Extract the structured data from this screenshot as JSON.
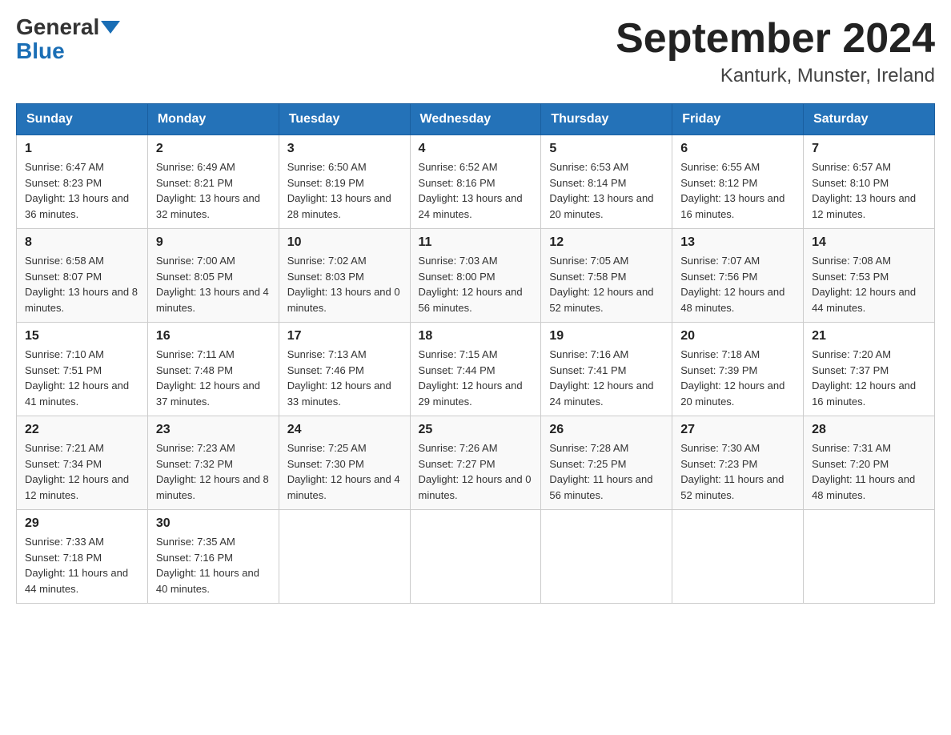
{
  "header": {
    "logo_general": "General",
    "logo_blue": "Blue",
    "title": "September 2024",
    "subtitle": "Kanturk, Munster, Ireland"
  },
  "days_of_week": [
    "Sunday",
    "Monday",
    "Tuesday",
    "Wednesday",
    "Thursday",
    "Friday",
    "Saturday"
  ],
  "weeks": [
    [
      {
        "day": "1",
        "sunrise": "6:47 AM",
        "sunset": "8:23 PM",
        "daylight": "13 hours and 36 minutes."
      },
      {
        "day": "2",
        "sunrise": "6:49 AM",
        "sunset": "8:21 PM",
        "daylight": "13 hours and 32 minutes."
      },
      {
        "day": "3",
        "sunrise": "6:50 AM",
        "sunset": "8:19 PM",
        "daylight": "13 hours and 28 minutes."
      },
      {
        "day": "4",
        "sunrise": "6:52 AM",
        "sunset": "8:16 PM",
        "daylight": "13 hours and 24 minutes."
      },
      {
        "day": "5",
        "sunrise": "6:53 AM",
        "sunset": "8:14 PM",
        "daylight": "13 hours and 20 minutes."
      },
      {
        "day": "6",
        "sunrise": "6:55 AM",
        "sunset": "8:12 PM",
        "daylight": "13 hours and 16 minutes."
      },
      {
        "day": "7",
        "sunrise": "6:57 AM",
        "sunset": "8:10 PM",
        "daylight": "13 hours and 12 minutes."
      }
    ],
    [
      {
        "day": "8",
        "sunrise": "6:58 AM",
        "sunset": "8:07 PM",
        "daylight": "13 hours and 8 minutes."
      },
      {
        "day": "9",
        "sunrise": "7:00 AM",
        "sunset": "8:05 PM",
        "daylight": "13 hours and 4 minutes."
      },
      {
        "day": "10",
        "sunrise": "7:02 AM",
        "sunset": "8:03 PM",
        "daylight": "13 hours and 0 minutes."
      },
      {
        "day": "11",
        "sunrise": "7:03 AM",
        "sunset": "8:00 PM",
        "daylight": "12 hours and 56 minutes."
      },
      {
        "day": "12",
        "sunrise": "7:05 AM",
        "sunset": "7:58 PM",
        "daylight": "12 hours and 52 minutes."
      },
      {
        "day": "13",
        "sunrise": "7:07 AM",
        "sunset": "7:56 PM",
        "daylight": "12 hours and 48 minutes."
      },
      {
        "day": "14",
        "sunrise": "7:08 AM",
        "sunset": "7:53 PM",
        "daylight": "12 hours and 44 minutes."
      }
    ],
    [
      {
        "day": "15",
        "sunrise": "7:10 AM",
        "sunset": "7:51 PM",
        "daylight": "12 hours and 41 minutes."
      },
      {
        "day": "16",
        "sunrise": "7:11 AM",
        "sunset": "7:48 PM",
        "daylight": "12 hours and 37 minutes."
      },
      {
        "day": "17",
        "sunrise": "7:13 AM",
        "sunset": "7:46 PM",
        "daylight": "12 hours and 33 minutes."
      },
      {
        "day": "18",
        "sunrise": "7:15 AM",
        "sunset": "7:44 PM",
        "daylight": "12 hours and 29 minutes."
      },
      {
        "day": "19",
        "sunrise": "7:16 AM",
        "sunset": "7:41 PM",
        "daylight": "12 hours and 24 minutes."
      },
      {
        "day": "20",
        "sunrise": "7:18 AM",
        "sunset": "7:39 PM",
        "daylight": "12 hours and 20 minutes."
      },
      {
        "day": "21",
        "sunrise": "7:20 AM",
        "sunset": "7:37 PM",
        "daylight": "12 hours and 16 minutes."
      }
    ],
    [
      {
        "day": "22",
        "sunrise": "7:21 AM",
        "sunset": "7:34 PM",
        "daylight": "12 hours and 12 minutes."
      },
      {
        "day": "23",
        "sunrise": "7:23 AM",
        "sunset": "7:32 PM",
        "daylight": "12 hours and 8 minutes."
      },
      {
        "day": "24",
        "sunrise": "7:25 AM",
        "sunset": "7:30 PM",
        "daylight": "12 hours and 4 minutes."
      },
      {
        "day": "25",
        "sunrise": "7:26 AM",
        "sunset": "7:27 PM",
        "daylight": "12 hours and 0 minutes."
      },
      {
        "day": "26",
        "sunrise": "7:28 AM",
        "sunset": "7:25 PM",
        "daylight": "11 hours and 56 minutes."
      },
      {
        "day": "27",
        "sunrise": "7:30 AM",
        "sunset": "7:23 PM",
        "daylight": "11 hours and 52 minutes."
      },
      {
        "day": "28",
        "sunrise": "7:31 AM",
        "sunset": "7:20 PM",
        "daylight": "11 hours and 48 minutes."
      }
    ],
    [
      {
        "day": "29",
        "sunrise": "7:33 AM",
        "sunset": "7:18 PM",
        "daylight": "11 hours and 44 minutes."
      },
      {
        "day": "30",
        "sunrise": "7:35 AM",
        "sunset": "7:16 PM",
        "daylight": "11 hours and 40 minutes."
      },
      null,
      null,
      null,
      null,
      null
    ]
  ]
}
